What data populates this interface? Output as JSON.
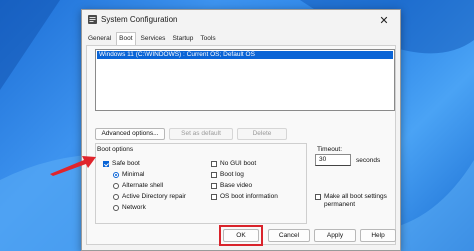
{
  "window": {
    "title": "System Configuration",
    "close_icon": "close-icon"
  },
  "tabs": [
    {
      "label": "General",
      "active": false
    },
    {
      "label": "Boot",
      "active": true
    },
    {
      "label": "Services",
      "active": false
    },
    {
      "label": "Startup",
      "active": false
    },
    {
      "label": "Tools",
      "active": false
    }
  ],
  "os_list": {
    "items": [
      "Windows 11 (C:\\WINDOWS) : Current OS; Default OS"
    ],
    "selected_index": 0
  },
  "list_buttons": {
    "advanced": "Advanced options...",
    "set_default": "Set as default",
    "delete": "Delete"
  },
  "boot_options": {
    "label": "Boot options",
    "safe_boot": {
      "label": "Safe boot",
      "checked": true
    },
    "radios": [
      {
        "label": "Minimal",
        "checked": true
      },
      {
        "label": "Alternate shell",
        "checked": false
      },
      {
        "label": "Active Directory repair",
        "checked": false
      },
      {
        "label": "Network",
        "checked": false
      }
    ],
    "checkboxes_right": [
      {
        "label": "No GUI boot",
        "checked": false
      },
      {
        "label": "Boot log",
        "checked": false
      },
      {
        "label": "Base video",
        "checked": false
      },
      {
        "label": "OS boot information",
        "checked": false
      }
    ]
  },
  "timeout": {
    "label": "Timeout:",
    "value": "30",
    "unit": "seconds"
  },
  "permanent": {
    "line1": "Make all boot settings",
    "line2": "permanent",
    "checked": false
  },
  "dialog_buttons": {
    "ok": "OK",
    "cancel": "Cancel",
    "apply": "Apply",
    "help": "Help"
  },
  "colors": {
    "accent": "#0a64d6",
    "highlight": "#d9232b"
  }
}
